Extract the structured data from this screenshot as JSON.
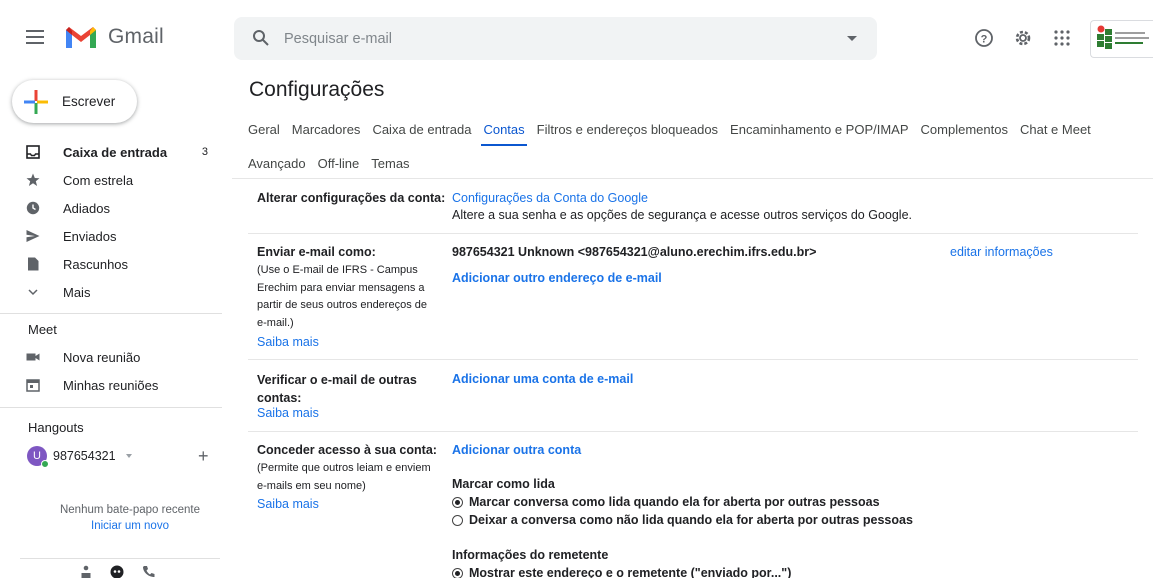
{
  "app": {
    "name": "Gmail",
    "search_placeholder": "Pesquisar e-mail"
  },
  "sidebar": {
    "compose_label": "Escrever",
    "items": [
      {
        "label": "Caixa de entrada",
        "count": "3",
        "icon": "inbox-icon",
        "active": true
      },
      {
        "label": "Com estrela",
        "icon": "star-icon"
      },
      {
        "label": "Adiados",
        "icon": "clock-icon"
      },
      {
        "label": "Enviados",
        "icon": "send-icon"
      },
      {
        "label": "Rascunhos",
        "icon": "draft-icon"
      },
      {
        "label": "Mais",
        "icon": "chevron-down-icon"
      }
    ],
    "meet": {
      "title": "Meet",
      "new_meeting": "Nova reunião",
      "my_meetings": "Minhas reuniões"
    },
    "hangouts": {
      "title": "Hangouts",
      "avatar_letter": "U",
      "user": "987654321",
      "no_chat": "Nenhum bate-papo recente",
      "start_new": "Iniciar um novo"
    }
  },
  "main": {
    "title": "Configurações",
    "tabs_row1": [
      "Geral",
      "Marcadores",
      "Caixa de entrada",
      "Contas",
      "Filtros e endereços bloqueados",
      "Encaminhamento e POP/IMAP",
      "Complementos",
      "Chat e Meet"
    ],
    "tabs_row2": [
      "Avançado",
      "Off-line",
      "Temas"
    ],
    "active_tab": "Contas",
    "sections": {
      "change_account": {
        "label": "Alterar configurações da conta:",
        "link": "Configurações da Conta do Google",
        "description": "Altere a sua senha e as opções de segurança e acesse outros serviços do Google."
      },
      "send_as": {
        "label": "Enviar e-mail como:",
        "note": "(Use o E-mail de IFRS - Campus Erechim para enviar mensagens a partir de seus outros endereços de e-mail.)",
        "learn_more": "Saiba mais",
        "address": "987654321 Unknown <987654321@aluno.erechim.ifrs.edu.br>",
        "edit": "editar informações",
        "add_address": "Adicionar outro endereço de e-mail"
      },
      "check_mail": {
        "label": "Verificar o e-mail de outras contas:",
        "learn_more": "Saiba mais",
        "add_account": "Adicionar uma conta de e-mail"
      },
      "grant_access": {
        "label": "Conceder acesso à sua conta:",
        "note": "(Permite que outros leiam e enviem e-mails em seu nome)",
        "learn_more": "Saiba mais",
        "add_other": "Adicionar outra conta",
        "mark_read_title": "Marcar como lida",
        "mark_read_opt1": "Marcar conversa como lida quando ela for aberta por outras pessoas",
        "mark_read_opt2": "Deixar a conversa como não lida quando ela for aberta por outras pessoas",
        "sender_info_title": "Informações do remetente",
        "sender_info_opt1": "Mostrar este endereço e o remetente (\"enviado por...\")"
      }
    }
  },
  "colors": {
    "link": "#1a73e8",
    "active_tab": "#0b57d0",
    "search_bg": "#f1f3f4"
  }
}
